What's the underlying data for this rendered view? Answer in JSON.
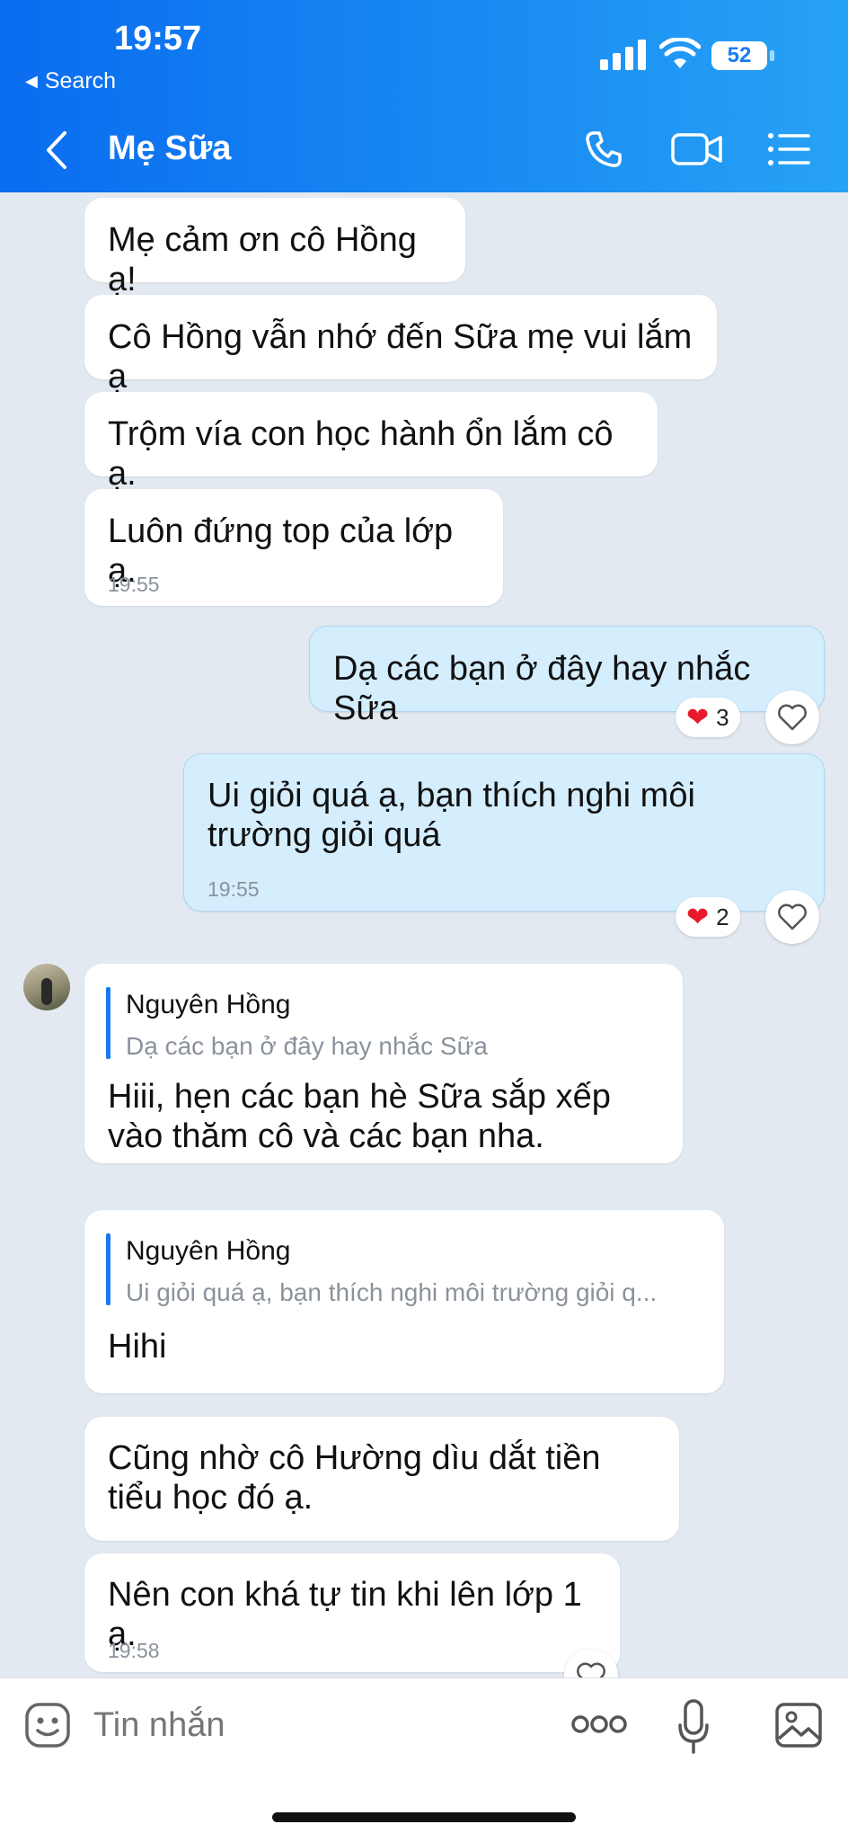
{
  "status_bar": {
    "time": "19:57",
    "back_app": "Search",
    "battery": "52"
  },
  "header": {
    "title": "Mẹ Sữa"
  },
  "messages": [
    {
      "text": "Mẹ cảm ơn cô Hồng ạ!"
    },
    {
      "text": "Cô Hồng vẫn nhớ đến Sữa mẹ vui lắm ạ"
    },
    {
      "text": "Trộm vía con học hành ổn lắm cô ạ."
    },
    {
      "text": "Luôn đứng top của lớp ạ.",
      "time": "19:55"
    },
    {
      "text": "Dạ các bạn ở đây hay nhắc Sữa",
      "reaction_count": "3"
    },
    {
      "text": "Ui giỏi quá ạ, bạn thích nghi môi trường giỏi quá",
      "time": "19:55",
      "reaction_count": "2"
    },
    {
      "reply_name": "Nguyên Hồng",
      "reply_quote": "Dạ các bạn ở đây hay nhắc Sữa",
      "text": "Hiii, hẹn các bạn hè Sữa sắp xếp vào thăm cô và các bạn nha."
    },
    {
      "reply_name": "Nguyên Hồng",
      "reply_quote": "Ui giỏi quá ạ, bạn thích nghi môi trường giỏi q...",
      "text": "Hihi"
    },
    {
      "text": "Cũng nhờ cô Hường dìu dắt tiền tiểu học đó ạ."
    },
    {
      "text": "Nên con khá tự tin khi lên lớp 1 ạ.",
      "time": "19:58"
    }
  ],
  "input": {
    "placeholder": "Tin nhắn"
  },
  "icons": {
    "back": "chevron-left-icon",
    "call": "phone-icon",
    "video": "video-camera-icon",
    "menu": "list-menu-icon",
    "sticker": "sticker-smile-icon",
    "more": "more-dots-icon",
    "mic": "microphone-icon",
    "gallery": "image-icon",
    "reaction": "heart-icon"
  },
  "colors": {
    "header_start": "#0a6cf0",
    "header_end": "#27a3f5",
    "outgoing_bubble": "#d4eefe",
    "chat_bg": "#e2e9f1",
    "reaction_heart": "#e8192c"
  }
}
